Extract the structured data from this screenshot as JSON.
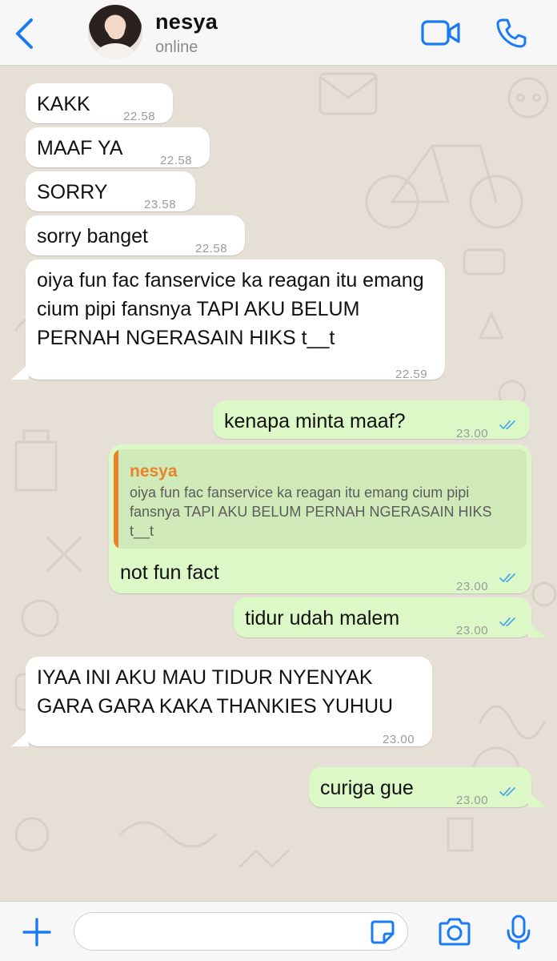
{
  "theme": {
    "accent": "#1a7cf5",
    "incoming_bubble": "#ffffff",
    "outgoing_bubble": "#dcf8c6",
    "quote_accent": "#e8832c",
    "read_ticks": "#4fa8e8"
  },
  "header": {
    "back_icon": "chevron-left-icon",
    "contact_name": "nesya",
    "status": "online",
    "video_icon": "video-camera-icon",
    "call_icon": "phone-icon"
  },
  "messages": [
    {
      "direction": "in",
      "text": "KAKK",
      "time": "22.58"
    },
    {
      "direction": "in",
      "text": "MAAF YA",
      "time": "22.58"
    },
    {
      "direction": "in",
      "text": "SORRY",
      "time": "23.58"
    },
    {
      "direction": "in",
      "text": "sorry banget",
      "time": "22.58"
    },
    {
      "direction": "in",
      "text": "oiya fun fac fanservice ka reagan itu emang cium pipi fansnya TAPI AKU BELUM PERNAH NGERASAIN HIKS t__t",
      "time": "22.59"
    },
    {
      "direction": "out",
      "text": "kenapa minta maaf?",
      "time": "23.00",
      "status": "read"
    },
    {
      "direction": "out",
      "text": "not fun fact",
      "time": "23.00",
      "status": "read",
      "reply_to": {
        "author": "nesya",
        "text": "oiya fun fac fanservice ka reagan itu emang cium pipi fansnya TAPI AKU BELUM PERNAH NGERASAIN HIKS t__t"
      }
    },
    {
      "direction": "out",
      "text": "tidur udah malem",
      "time": "23.00",
      "status": "read"
    },
    {
      "direction": "in",
      "text": "IYAA INI AKU MAU TIDUR NYENYAK GARA GARA KAKA THANKIES YUHUU",
      "time": "23.00"
    },
    {
      "direction": "out",
      "text": "curiga gue",
      "time": "23.00",
      "status": "read"
    }
  ],
  "input_bar": {
    "plus_icon": "plus-icon",
    "message_value": "",
    "message_placeholder": "",
    "sticker_icon": "sticker-icon",
    "camera_icon": "camera-icon",
    "mic_icon": "microphone-icon"
  }
}
